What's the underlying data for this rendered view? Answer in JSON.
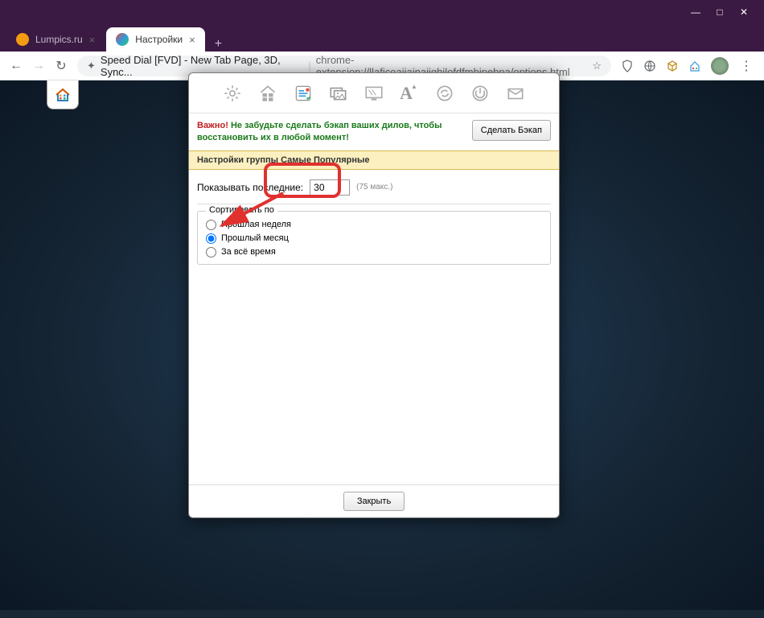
{
  "titlebar": {
    "min": "—",
    "max": "□",
    "close": "✕"
  },
  "tabs": {
    "tab1": {
      "label": "Lumpics.ru"
    },
    "tab2": {
      "label": "Настройки"
    },
    "new": "+"
  },
  "address": {
    "back": "←",
    "forward": "→",
    "reload": "↻",
    "site_icon": "✦",
    "page_title": "Speed Dial [FVD] - New Tab Page, 3D, Sync...",
    "url": "chrome-extension://llaficoajjainaijghjlofdfmbjpebpa/options.html",
    "star": "☆"
  },
  "toolbar": {
    "gear": "⚙",
    "dials": "▦",
    "popular": "📋",
    "recent": "🖼",
    "bg": "▥",
    "font": "A",
    "sync": "↺",
    "power": "⏻",
    "import": "✉"
  },
  "notice": {
    "important": "Важно!",
    "msg": "Не забудьте сделать бэкап ваших дилов, чтобы восстановить их в любой момент!",
    "backup_btn": "Сделать Бэкап"
  },
  "section": {
    "header": "Настройки группы Самые Популярные"
  },
  "show": {
    "label": "Показывать последние:",
    "value": "30",
    "max_label": "(75 макс.)"
  },
  "sort": {
    "legend": "Сортировать по",
    "opt1": "Прошлая неделя",
    "opt2": "Прошлый месяц",
    "opt3": "За всё время"
  },
  "footer": {
    "close": "Закрыть"
  }
}
